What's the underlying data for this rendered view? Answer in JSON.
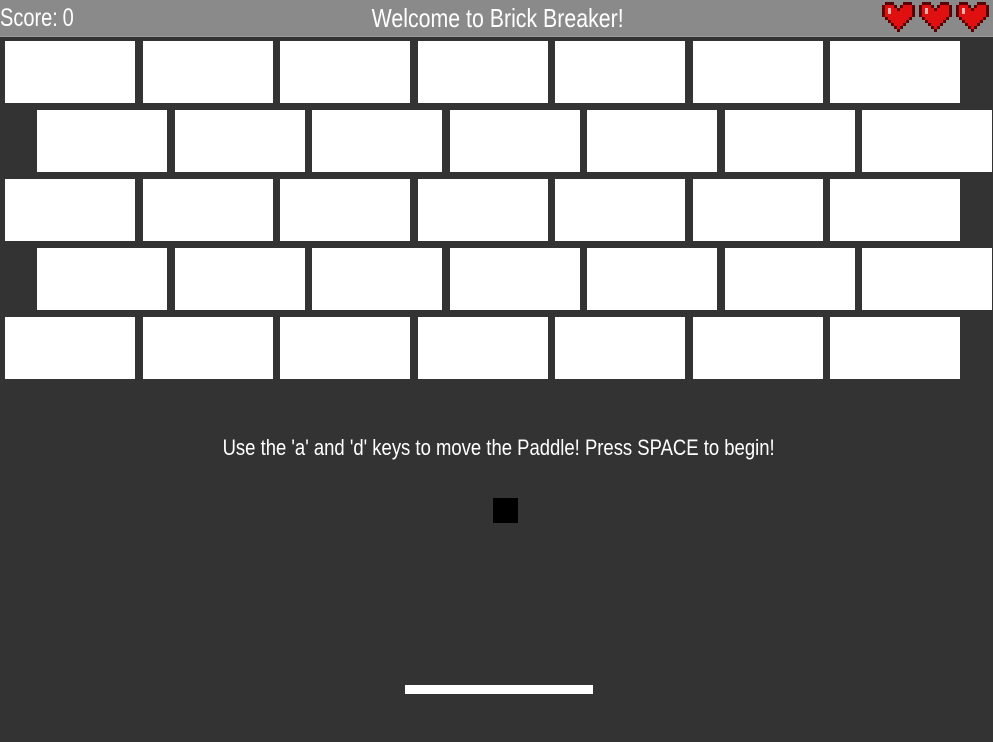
{
  "hud": {
    "score_label": "Score:",
    "score_value": "0",
    "title": "Welcome to Brick Breaker!",
    "lives": 3,
    "life_icon": "heart-icon"
  },
  "bricks": {
    "rows": [
      7,
      7,
      7,
      7,
      7
    ],
    "color": "#ffffff"
  },
  "instructions": "Use the 'a' and 'd' keys to move the Paddle! Press SPACE to begin!",
  "colors": {
    "background": "#333333",
    "hud_bar": "#8a8a8a",
    "brick": "#ffffff",
    "paddle": "#ffffff",
    "ball": "#000000",
    "heart": "#e01010"
  }
}
